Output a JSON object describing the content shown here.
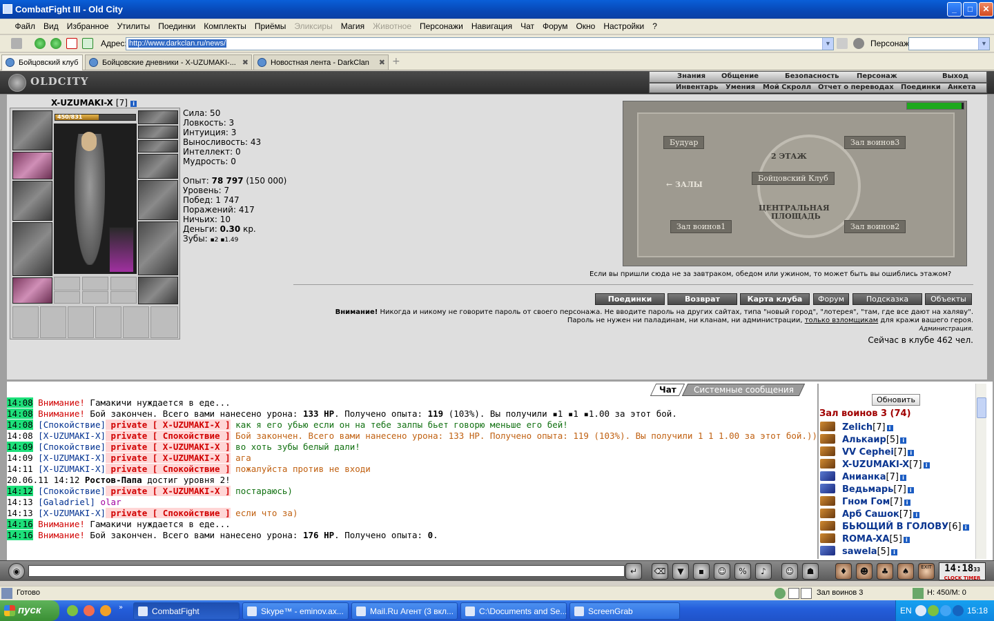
{
  "window": {
    "title": "CombatFight III - Old City",
    "min": "_",
    "max": "□",
    "close": "✕"
  },
  "menu": [
    {
      "label": "Файл",
      "disabled": false
    },
    {
      "label": "Вид",
      "disabled": false
    },
    {
      "label": "Избранное",
      "disabled": false
    },
    {
      "label": "Утилиты",
      "disabled": false
    },
    {
      "label": "Поединки",
      "disabled": false
    },
    {
      "label": "Комплекты",
      "disabled": false
    },
    {
      "label": "Приёмы",
      "disabled": false
    },
    {
      "label": "Эликсиры",
      "disabled": true
    },
    {
      "label": "Магия",
      "disabled": false
    },
    {
      "label": "Животное",
      "disabled": true
    },
    {
      "label": "Персонажи",
      "disabled": false
    },
    {
      "label": "Навигация",
      "disabled": false
    },
    {
      "label": "Чат",
      "disabled": false
    },
    {
      "label": "Форум",
      "disabled": false
    },
    {
      "label": "Окно",
      "disabled": false
    },
    {
      "label": "Настройки",
      "disabled": false
    },
    {
      "label": "?",
      "disabled": false
    }
  ],
  "address": {
    "label": "Адрес:",
    "url": "http://www.darkclan.ru/news/",
    "persona_label": "Персонаж:"
  },
  "tabs": [
    {
      "label": "Бойцовский клуб",
      "active": true
    },
    {
      "label": "Бойцовские дневники - X-UZUMAKI-...",
      "active": false
    },
    {
      "label": "Новостная лента - DarkClan",
      "active": false
    }
  ],
  "game_nav": {
    "top": [
      "Знания",
      "Общение",
      "Безопасность",
      "Персонаж",
      "Выход"
    ],
    "bottom": [
      "Инвентарь",
      "Умения",
      "Мой Скролл",
      "Отчет о переводах",
      "Поединки",
      "Анкета"
    ]
  },
  "logo": "OLDCITY",
  "character": {
    "name": "X-UZUMAKI-X",
    "level": "[7]",
    "hp": "450/831",
    "hp_fraction": 0.54
  },
  "stats": {
    "strength": "Сила: 50",
    "agility": "Ловкость: 3",
    "intuition": "Интуиция: 3",
    "endurance": "Выносливость: 43",
    "intellect": "Интеллект: 0",
    "wisdom": "Мудрость: 0",
    "exp_label": "Опыт: ",
    "exp_value": "78 797",
    "exp_next": " (150 000)",
    "level": "Уровень: 7",
    "wins": "Побед: 1 747",
    "losses": "Поражений: 417",
    "draws": "Ничьих: 10",
    "money_label": "Деньги: ",
    "money_value": "0.30",
    "money_unit": " кр.",
    "teeth_label": "Зубы: ",
    "teeth_a": "2",
    "teeth_b": "1.49"
  },
  "map": {
    "boudoir": "Будуар",
    "hall3": "Зал воинов3",
    "floor2": "2 ЭТАЖ",
    "club": "Бойцовский Клуб",
    "halls": "← ЗАЛЫ",
    "central1": "ЦЕНТРАЛЬНАЯ",
    "central2": "ПЛОЩАДЬ",
    "hall1": "Зал воинов1",
    "hall2": "Зал воинов2",
    "hint": "Если вы пришли сюда не за завтраком, обедом или ужином, то может быть вы ошиблись этажом?"
  },
  "buttons": [
    "Поединки",
    "Возврат",
    "Карта клуба",
    "Форум",
    "Подсказка",
    "Объекты"
  ],
  "warning": {
    "bold": "Внимание!",
    "line1": " Никогда и никому не говорите пароль от своего персонажа. Не вводите пароль на других сайтах, типа \"новый город\", \"лотерея\", \"там, где все дают на халяву\".",
    "line2a": "Пароль не нужен ни паладинам, ни кланам, ни администрации, ",
    "line2u": "только взломщикам",
    "line2b": " для кражи вашего героя.",
    "sign": "Администрация."
  },
  "online": "Сейчас в клубе 462 чел.",
  "chat_tabs": {
    "chat": "Чат",
    "system": "Системные сообщения"
  },
  "chat": [
    {
      "time": "14:08",
      "hl": true,
      "parts": [
        {
          "t": "Внимание!",
          "c": "red"
        },
        {
          "t": " Гамакичи нуждается в еде...",
          "c": ""
        }
      ]
    },
    {
      "time": "14:08",
      "hl": true,
      "parts": [
        {
          "t": "Внимание!",
          "c": "red"
        },
        {
          "t": " Бой закончен. Всего вами нанесено урона: ",
          "c": ""
        },
        {
          "t": "133 HP",
          "c": "b"
        },
        {
          "t": ". Получено опыта: ",
          "c": ""
        },
        {
          "t": "119",
          "c": "b"
        },
        {
          "t": " (103%). Вы получили ▪1 ▪1 ▪1.00 за этот бой.",
          "c": ""
        }
      ]
    },
    {
      "time": "14:08",
      "hl": true,
      "parts": [
        {
          "t": "[Спокойствие]",
          "c": "blue"
        },
        {
          "t": " private [ X-UZUMAKI-X ]",
          "c": "pvtb"
        },
        {
          "t": " как я его убью если он на тебе залпы бьет говорю меньше его бей!",
          "c": "green"
        }
      ]
    },
    {
      "time": "14:08",
      "hl": false,
      "parts": [
        {
          "t": "[X-UZUMAKI-X]",
          "c": "blue"
        },
        {
          "t": " private [ Спокойствие ]",
          "c": "pvtb"
        },
        {
          "t": " Бой закончен. Всего вами нанесено урона: 133 HP. Получено опыта: 119 (103%). Вы получили 1 1 1.00 за этот бой.)))",
          "c": "orange"
        }
      ]
    },
    {
      "time": "14:09",
      "hl": true,
      "parts": [
        {
          "t": "[Спокойствие]",
          "c": "blue"
        },
        {
          "t": " private [ X-UZUMAKI-X ]",
          "c": "pvtb"
        },
        {
          "t": " во хоть зубы белый дали!",
          "c": "green"
        }
      ]
    },
    {
      "time": "14:09",
      "hl": false,
      "parts": [
        {
          "t": "[X-UZUMAKI-X]",
          "c": "blue"
        },
        {
          "t": " private [ X-UZUMAKI-X ]",
          "c": "pvtb"
        },
        {
          "t": " ага",
          "c": "orange"
        }
      ]
    },
    {
      "time": "14:11",
      "hl": false,
      "parts": [
        {
          "t": "[X-UZUMAKI-X]",
          "c": "blue"
        },
        {
          "t": " private [ Спокойствие ]",
          "c": "pvtb"
        },
        {
          "t": " пожалуйста против не входи",
          "c": "orange"
        }
      ]
    },
    {
      "time": "20.06.11 14:12",
      "hl": false,
      "parts": [
        {
          "t": " Ростов-Папа",
          "c": "b"
        },
        {
          "t": " достиг уровня 2!",
          "c": ""
        }
      ]
    },
    {
      "time": "14:12",
      "hl": true,
      "parts": [
        {
          "t": "[Спокойствие]",
          "c": "blue"
        },
        {
          "t": " private [ X-UZUMAKI-X ]",
          "c": "pvtb"
        },
        {
          "t": " постараюсь)",
          "c": "green"
        }
      ]
    },
    {
      "time": "14:13",
      "hl": false,
      "parts": [
        {
          "t": "[Galadriel]",
          "c": "blue"
        },
        {
          "t": " olar",
          "c": "mag"
        }
      ]
    },
    {
      "time": "14:13",
      "hl": false,
      "parts": [
        {
          "t": "[X-UZUMAKI-X]",
          "c": "blue"
        },
        {
          "t": " private [ Спокойствие ]",
          "c": "pvtb"
        },
        {
          "t": " если что за)",
          "c": "orange"
        }
      ]
    },
    {
      "time": "14:16",
      "hl": true,
      "parts": [
        {
          "t": "Внимание!",
          "c": "red"
        },
        {
          "t": " Гамакичи нуждается в еде...",
          "c": ""
        }
      ]
    },
    {
      "time": "14:16",
      "hl": true,
      "parts": [
        {
          "t": "Внимание!",
          "c": "red"
        },
        {
          "t": " Бой закончен. Всего вами нанесено урона: ",
          "c": ""
        },
        {
          "t": "176 HP",
          "c": "b"
        },
        {
          "t": ". Получено опыта: ",
          "c": ""
        },
        {
          "t": "0",
          "c": "b"
        },
        {
          "t": ".",
          "c": ""
        }
      ]
    }
  ],
  "room": {
    "refresh": "Обновить",
    "title": "Зал воинов 3 (74)",
    "users": [
      {
        "name": "Zelich",
        "lvl": "[7]",
        "blue": false
      },
      {
        "name": "Алькаир",
        "lvl": "[5]",
        "blue": false
      },
      {
        "name": "VV Cephei",
        "lvl": "[7]",
        "blue": false
      },
      {
        "name": "X-UZUMAKI-X",
        "lvl": "[7]",
        "blue": false
      },
      {
        "name": "Анианка",
        "lvl": "[7]",
        "blue": true
      },
      {
        "name": "Ведьмарь",
        "lvl": "[7]",
        "blue": true
      },
      {
        "name": "Гном Гом",
        "lvl": "[7]",
        "blue": false
      },
      {
        "name": "Арб Сашок",
        "lvl": "[7]",
        "blue": false
      },
      {
        "name": "БЬЮЩИЙ В ГОЛОВУ",
        "lvl": "[6]",
        "blue": false
      },
      {
        "name": "ROMA-XA",
        "lvl": "[5]",
        "blue": false
      },
      {
        "name": "sawela",
        "lvl": "[5]",
        "blue": true
      }
    ]
  },
  "clock": {
    "time": "14:18",
    "sec": "33",
    "label_a": "CLOCK",
    "label_b": "TIMER",
    "exit": "EXIT"
  },
  "status": {
    "ready": "Готово",
    "room": "Зал воинов 3",
    "hp": "H: 450/M: 0"
  },
  "taskbar": {
    "start": "пуск",
    "items": [
      "CombatFight",
      "Skype™ - eminov.ax...",
      "Mail.Ru Агент (3 вкл...",
      "C:\\Documents and Se...",
      "ScreenGrab"
    ],
    "lang": "EN",
    "time": "15:18"
  },
  "icon_names": [
    "window-app-icon",
    "back-icon",
    "forward-icon",
    "stop-icon",
    "refresh-icon",
    "chat-send-icon",
    "smile-icon",
    "clock-icon"
  ]
}
